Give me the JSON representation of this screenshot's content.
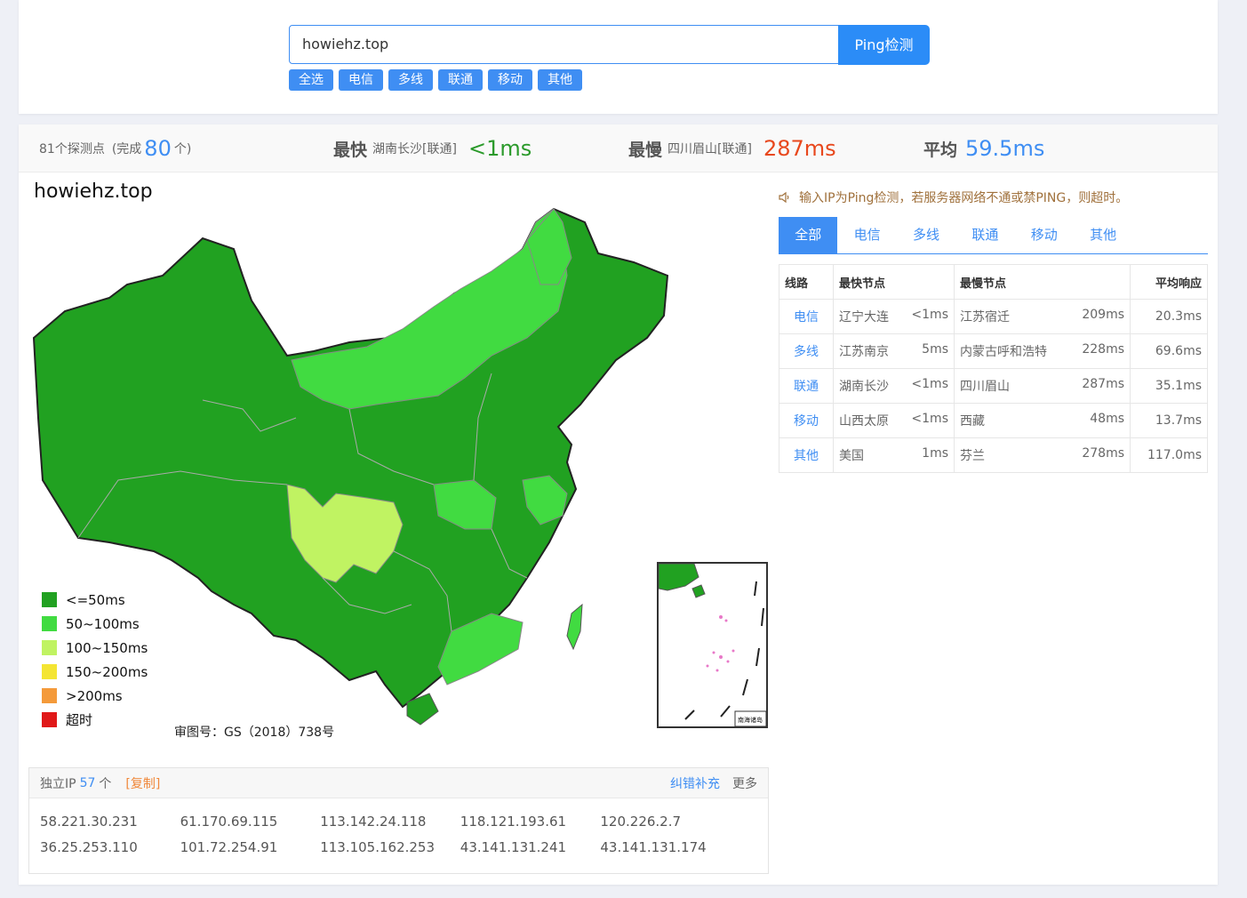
{
  "search": {
    "value": "howiehz.top",
    "button_label": "Ping检测",
    "isp_tags": [
      "全选",
      "电信",
      "多线",
      "联通",
      "移动",
      "其他"
    ]
  },
  "stats": {
    "probes_label": "81个探测点",
    "complete_prefix": "(完成",
    "complete_count": "80",
    "complete_suffix": "个)",
    "fastest_label": "最快",
    "fastest_location": "湖南长沙[联通]",
    "fastest_value": "<1ms",
    "slowest_label": "最慢",
    "slowest_location": "四川眉山[联通]",
    "slowest_value": "287ms",
    "average_label": "平均",
    "average_value": "59.5ms"
  },
  "map": {
    "title": "howiehz.top",
    "license": "审图号：GS（2018）738号",
    "legend": [
      {
        "label": "<=50ms",
        "color": "#21a121"
      },
      {
        "label": "50~100ms",
        "color": "#41db41"
      },
      {
        "label": "100~150ms",
        "color": "#c0f362"
      },
      {
        "label": "150~200ms",
        "color": "#f4e533"
      },
      {
        "label": ">200ms",
        "color": "#f49a3a"
      },
      {
        "label": "超时",
        "color": "#e01818"
      }
    ],
    "inset_title": "南海诸岛"
  },
  "ip_box": {
    "label": "独立IP",
    "count": "57",
    "unit": "个",
    "copy_label": "[复制]",
    "report_label": "纠错补充",
    "more_label": "更多",
    "ips": [
      "58.221.30.231",
      "61.170.69.115",
      "113.142.24.118",
      "118.121.193.61",
      "120.226.2.7",
      "36.25.253.110",
      "101.72.254.91",
      "113.105.162.253",
      "43.141.131.241",
      "43.141.131.174"
    ]
  },
  "notice": "输入IP为Ping检测，若服务器网络不通或禁PING，则超时。",
  "tabs": [
    "全部",
    "电信",
    "多线",
    "联通",
    "移动",
    "其他"
  ],
  "table": {
    "headers": [
      "线路",
      "最快节点",
      "最慢节点",
      "平均响应"
    ],
    "rows": [
      {
        "line": "电信",
        "fast_node": "辽宁大连",
        "fast_time": "<1ms",
        "slow_node": "江苏宿迁",
        "slow_time": "209ms",
        "avg": "20.3ms"
      },
      {
        "line": "多线",
        "fast_node": "江苏南京",
        "fast_time": "5ms",
        "slow_node": "内蒙古呼和浩特",
        "slow_time": "228ms",
        "avg": "69.6ms"
      },
      {
        "line": "联通",
        "fast_node": "湖南长沙",
        "fast_time": "<1ms",
        "slow_node": "四川眉山",
        "slow_time": "287ms",
        "avg": "35.1ms"
      },
      {
        "line": "移动",
        "fast_node": "山西太原",
        "fast_time": "<1ms",
        "slow_node": "西藏",
        "slow_time": "48ms",
        "avg": "13.7ms"
      },
      {
        "line": "其他",
        "fast_node": "美国",
        "fast_time": "1ms",
        "slow_node": "芬兰",
        "slow_time": "278ms",
        "avg": "117.0ms"
      }
    ]
  }
}
